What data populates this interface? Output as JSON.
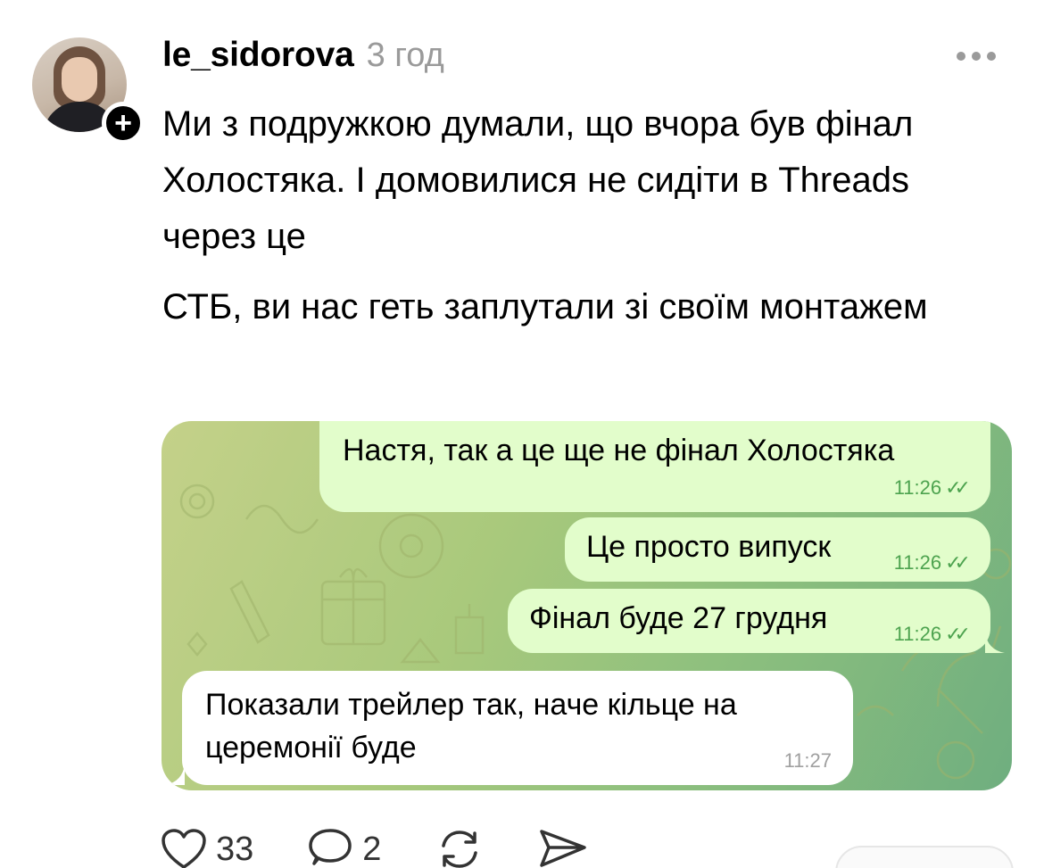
{
  "post": {
    "username": "le_sidorova",
    "time": "3 год",
    "paragraphs": [
      "Ми з подружкою думали, що вчора був фінал Холостяка. І домовилися не сидіти в Threads через це",
      "СТБ, ви нас геть заплутали зі своїм монтажем"
    ]
  },
  "chat": {
    "messages": [
      {
        "text": "Настя, так а це ще не фінал Холостяка",
        "time": "11:26",
        "direction": "outgoing",
        "status": "read"
      },
      {
        "text": "Це просто випуск",
        "time": "11:26",
        "direction": "outgoing",
        "status": "read"
      },
      {
        "text": "Фінал буде 27 грудня",
        "time": "11:26",
        "direction": "outgoing",
        "status": "read"
      },
      {
        "text": "Показали трейлер так, наче кільце на церемонії буде",
        "time": "11:27",
        "direction": "incoming"
      }
    ]
  },
  "actions": {
    "likes": "33",
    "replies": "2"
  },
  "icons": {
    "follow": "plus-icon",
    "more": "more-dots-icon",
    "like": "heart-icon",
    "reply": "comment-icon",
    "repost": "repost-icon",
    "share": "send-icon",
    "read": "double-check-icon"
  },
  "colors": {
    "outgoing_bubble": "#e2fdcb",
    "incoming_bubble": "#ffffff",
    "timestamp_green": "#4da34f",
    "muted_gray": "#9a9a9a"
  }
}
